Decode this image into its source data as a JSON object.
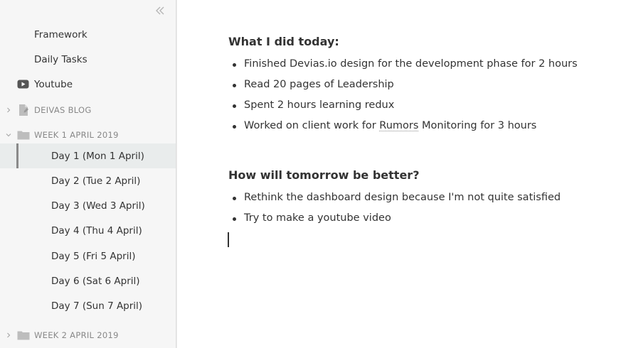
{
  "sidebar": {
    "collapse_icon": "double-chevron-left",
    "items": [
      {
        "label": "Framework"
      },
      {
        "label": "Daily Tasks"
      },
      {
        "label": "Youtube",
        "icon": "youtube-icon"
      },
      {
        "label": "DEIVAS BLOG",
        "icon": "document-icon"
      },
      {
        "label": "WEEK 1 APRIL 2019",
        "icon": "folder-icon",
        "expanded": true
      },
      {
        "label": "Day 1 (Mon 1 April)",
        "selected": true
      },
      {
        "label": "Day 2 (Tue 2 April)"
      },
      {
        "label": "Day 3 (Wed 3 April)"
      },
      {
        "label": "Day 4 (Thu 4 April)"
      },
      {
        "label": "Day 5 (Fri 5 April)"
      },
      {
        "label": "Day 6 (Sat 6 April)"
      },
      {
        "label": "Day 7 (Sun 7 April)"
      },
      {
        "label": "WEEK 2 APRIL 2019",
        "icon": "folder-icon",
        "expanded": false
      }
    ]
  },
  "editor": {
    "section1": {
      "heading": "What I did today:",
      "bullets": [
        "Finished Devias.io design for the development phase for 2 hours",
        "Read 20 pages of Leadership",
        "Spent 2 hours learning redux",
        {
          "before": "Worked on client work for ",
          "flagged": "Rumors",
          "after": " Monitoring for 3 hours"
        }
      ]
    },
    "section2": {
      "heading": "How will tomorrow be better?",
      "bullets": [
        "Rethink the dashboard design because I'm not quite satisfied",
        "Try to make a youtube video"
      ]
    }
  },
  "colors": {
    "sidebar_bg": "#f6f6f6",
    "selected_bg": "#e9ecec",
    "selected_bar": "#8a8a8a",
    "text": "#333333",
    "muted": "#888888"
  }
}
